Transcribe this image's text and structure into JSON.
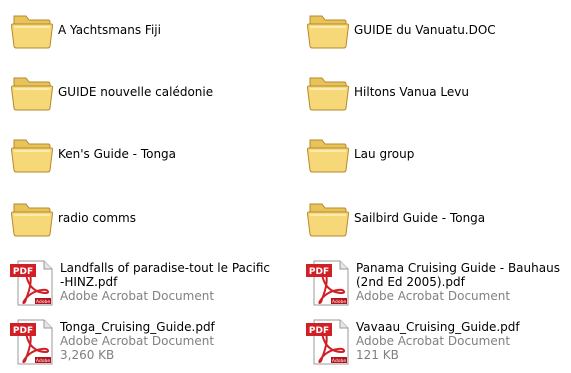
{
  "colors": {
    "folder_body": "#f6d878",
    "folder_dark": "#dfb33d",
    "pdf_red": "#d11f26",
    "secondary_text": "#808080"
  },
  "items": [
    {
      "type": "folder",
      "icon": "folder-icon",
      "name": "A Yachtsmans Fiji"
    },
    {
      "type": "folder",
      "icon": "folder-icon",
      "name": "GUIDE du Vanuatu.DOC"
    },
    {
      "type": "folder",
      "icon": "folder-icon",
      "name": "GUIDE nouvelle calédonie"
    },
    {
      "type": "folder",
      "icon": "folder-icon",
      "name": "Hiltons Vanua Levu"
    },
    {
      "type": "folder",
      "icon": "folder-icon",
      "name": "Ken's Guide - Tonga"
    },
    {
      "type": "folder",
      "icon": "folder-icon",
      "name": "Lau group"
    },
    {
      "type": "folder",
      "icon": "folder-icon",
      "name": "radio comms"
    },
    {
      "type": "folder",
      "icon": "folder-icon",
      "name": "Sailbird Guide - Tonga"
    },
    {
      "type": "pdf",
      "icon": "pdf-icon",
      "badge": "PDF",
      "brand": "Adobe",
      "lines": [
        "Landfalls of paradise-tout le Pacific",
        "-HINZ.pdf"
      ],
      "kind": "Adobe Acrobat Document"
    },
    {
      "type": "pdf",
      "icon": "pdf-icon",
      "badge": "PDF",
      "brand": "Adobe",
      "lines": [
        "Panama Cruising Guide - Bauhaus",
        "(2nd Ed 2005).pdf"
      ],
      "kind": "Adobe Acrobat Document"
    },
    {
      "type": "pdf",
      "icon": "pdf-icon",
      "badge": "PDF",
      "brand": "Adobe",
      "lines": [
        "Tonga_Cruising_Guide.pdf"
      ],
      "kind": "Adobe Acrobat Document",
      "size": "3,260 KB"
    },
    {
      "type": "pdf",
      "icon": "pdf-icon",
      "badge": "PDF",
      "brand": "Adobe",
      "lines": [
        "Vavaau_Cruising_Guide.pdf"
      ],
      "kind": "Adobe Acrobat Document",
      "size": "121 KB"
    }
  ]
}
